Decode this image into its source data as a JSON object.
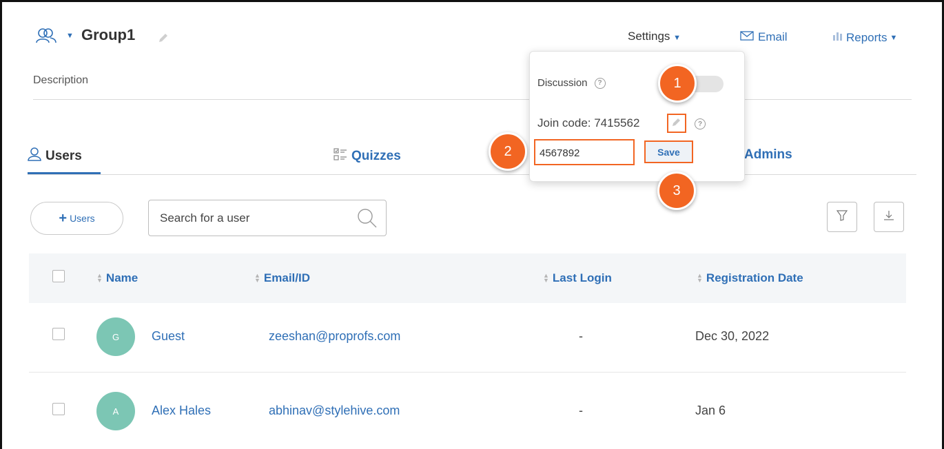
{
  "header": {
    "group_name": "Group1",
    "settings_label": "Settings",
    "email_label": "Email",
    "reports_label": "Reports",
    "description_label": "Description"
  },
  "tabs": [
    {
      "label": "Users",
      "active": true
    },
    {
      "label": "Quizzes",
      "active": false
    },
    {
      "label": "Admins",
      "active": false
    }
  ],
  "toolbar": {
    "add_users_label": "Users",
    "search_placeholder": "Search for a user"
  },
  "table": {
    "columns": [
      "Name",
      "Email/ID",
      "Last Login",
      "Registration Date"
    ],
    "rows": [
      {
        "initial": "G",
        "name": "Guest",
        "email": "zeeshan@proprofs.com",
        "last_login": "-",
        "registration_date": "Dec 30, 2022"
      },
      {
        "initial": "A",
        "name": "Alex Hales",
        "email": "abhinav@stylehive.com",
        "last_login": "-",
        "registration_date": "Jan 6"
      }
    ]
  },
  "settings_popover": {
    "discussion_label": "Discussion",
    "help_glyph": "?",
    "join_code_label": "Join code: 7415562",
    "join_code_input_value": "4567892",
    "save_label": "Save"
  },
  "annotations": [
    "1",
    "2",
    "3"
  ],
  "colors": {
    "accent": "#2f6fb6",
    "annotation": "#f26522",
    "avatar": "#7cc6b4",
    "header_row": "#f4f6f8"
  },
  "icons": [
    "users-group-icon",
    "pencil-icon",
    "email-icon",
    "reports-icon",
    "user-icon",
    "quiz-list-icon",
    "search-icon",
    "filter-icon",
    "download-icon",
    "help-icon"
  ]
}
